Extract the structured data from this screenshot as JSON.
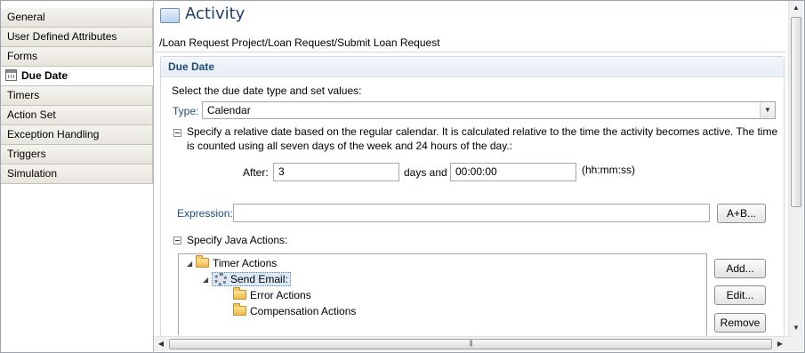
{
  "tabs": [
    {
      "label": "General"
    },
    {
      "label": "User Defined Attributes"
    },
    {
      "label": "Forms"
    },
    {
      "label": "Due Date"
    },
    {
      "label": "Timers"
    },
    {
      "label": "Action Set"
    },
    {
      "label": "Exception Handling"
    },
    {
      "label": "Triggers"
    },
    {
      "label": "Simulation"
    }
  ],
  "active_tab": "Due Date",
  "header": {
    "title": "Activity",
    "breadcrumb": "/Loan Request Project/Loan Request/Submit Loan Request"
  },
  "section": {
    "title": "Due Date",
    "instruction": "Select the due date type and set values:",
    "type_label": "Type:",
    "type_value": "Calendar",
    "description_line1": "Specify a relative date based on the regular calendar. It is calculated relative to the time the activity becomes active. The time",
    "description_line2": "is counted using all seven days of the week and 24 hours of the day.:",
    "after_label": "After:",
    "after_value": "3",
    "days_and_label": "days and",
    "time_value": "00:00:00",
    "time_format": "(hh:mm:ss)",
    "expression_label": "Expression:",
    "expression_value": "",
    "expression_button": "A+B...",
    "java_actions_label": "Specify Java Actions:"
  },
  "tree": {
    "timer_actions": "Timer Actions",
    "send_email": "Send Email:",
    "error_actions": "Error Actions",
    "compensation_actions": "Compensation Actions"
  },
  "buttons": {
    "add": "Add...",
    "edit": "Edit...",
    "remove": "Remove"
  },
  "icons": {
    "header": "activity-icon",
    "due_date_tab": "calendar-icon",
    "folder": "folder-icon",
    "send_email": "gear-icon"
  },
  "colors": {
    "title_blue": "#1f3f6a",
    "section_blue": "#1e4b7a",
    "selection": "#dceaf8"
  }
}
